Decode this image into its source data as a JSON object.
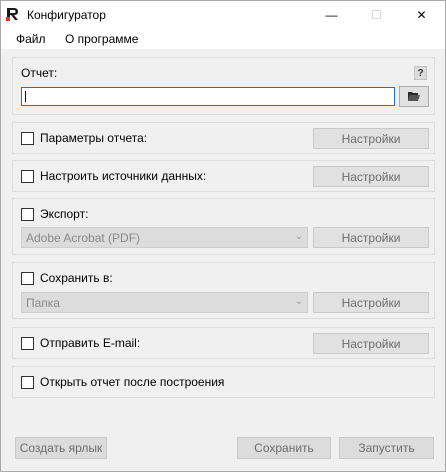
{
  "window": {
    "title": "Конфигуратор",
    "min_glyph": "—",
    "max_glyph": "☐",
    "close_glyph": "✕"
  },
  "menu": {
    "items": [
      {
        "label": "Файл"
      },
      {
        "label": "О программе"
      }
    ]
  },
  "report": {
    "label": "Отчет:",
    "help": "?",
    "value": ""
  },
  "sections": {
    "params": {
      "label": "Параметры отчета:",
      "button": "Настройки",
      "checked": false
    },
    "sources": {
      "label": "Настроить источники данных:",
      "button": "Настройки",
      "checked": false
    },
    "export": {
      "label": "Экспорт:",
      "select_value": "Adobe Acrobat (PDF)",
      "button": "Настройки",
      "checked": false
    },
    "save": {
      "label": "Сохранить в:",
      "select_value": "Папка",
      "button": "Настройки",
      "checked": false
    },
    "email": {
      "label": "Отправить E-mail:",
      "button": "Настройки",
      "checked": false
    },
    "open": {
      "label": "Открыть отчет после построения",
      "checked": false
    }
  },
  "bottom": {
    "shortcut": "Создать ярлык",
    "save": "Сохранить",
    "run": "Запустить"
  },
  "colors": {
    "window_bg": "#f0f0f0",
    "accent_border": "#1a73c6",
    "disabled_text": "#6d6d6d"
  }
}
